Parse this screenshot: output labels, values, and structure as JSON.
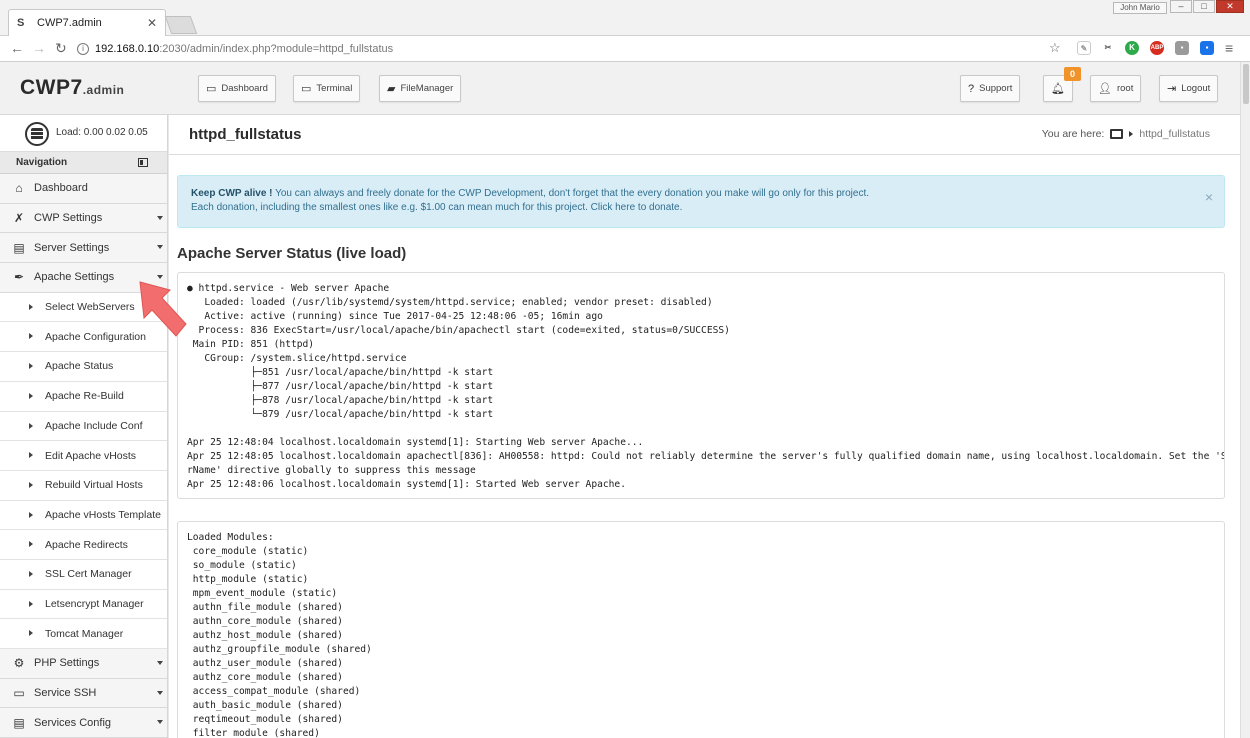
{
  "browser": {
    "tab_title": "CWP7.admin",
    "tab_favicon": "S",
    "user_badge": "John Mario",
    "url_host": "192.168.0.10",
    "url_rest": ":2030/admin/index.php?module=httpd_fullstatus"
  },
  "header": {
    "brand": "CWP7",
    "brand_sub": ".admin",
    "buttons": {
      "dashboard": "Dashboard",
      "terminal": "Terminal",
      "filemanager": "FileManager",
      "support": "Support",
      "user": "root",
      "logout": "Logout"
    },
    "notification_count": "0"
  },
  "sidebar": {
    "load": "Load: 0.00  0.02  0.05",
    "nav_heading": "Navigation",
    "items": [
      {
        "label": "Dashboard",
        "icon": "home-icon"
      },
      {
        "label": "CWP Settings",
        "icon": "tools-icon"
      },
      {
        "label": "Server Settings",
        "icon": "server-icon"
      },
      {
        "label": "Apache Settings",
        "icon": "feather-icon"
      }
    ],
    "apache_sub": [
      "Select WebServers",
      "Apache Configuration",
      "Apache Status",
      "Apache Re-Build",
      "Apache Include Conf",
      "Edit Apache vHosts",
      "Rebuild Virtual Hosts",
      "Apache vHosts Template",
      "Apache Redirects",
      "SSL Cert Manager",
      "Letsencrypt Manager",
      "Tomcat Manager"
    ],
    "items_after": [
      {
        "label": "PHP Settings",
        "icon": "gear-icon"
      },
      {
        "label": "Service SSH",
        "icon": "monitor-icon"
      },
      {
        "label": "Services Config",
        "icon": "server-icon"
      }
    ]
  },
  "main": {
    "page_title": "httpd_fullstatus",
    "you_are_here": "You are here:",
    "crumb_current": "httpd_fullstatus",
    "alert_bold": "Keep CWP alive !",
    "alert_line1": " You can always and freely donate for the CWP Development, don't forget that the every donation you make will go only for this project.",
    "alert_line2": "Each donation, including the smallest ones like e.g. $1.00 can mean much for this project. Click here to donate.",
    "section_title": "Apache Server Status (live load)",
    "status_output": "● httpd.service - Web server Apache\n   Loaded: loaded (/usr/lib/systemd/system/httpd.service; enabled; vendor preset: disabled)\n   Active: active (running) since Tue 2017-04-25 12:48:06 -05; 16min ago\n  Process: 836 ExecStart=/usr/local/apache/bin/apachectl start (code=exited, status=0/SUCCESS)\n Main PID: 851 (httpd)\n   CGroup: /system.slice/httpd.service\n           ├─851 /usr/local/apache/bin/httpd -k start\n           ├─877 /usr/local/apache/bin/httpd -k start\n           ├─878 /usr/local/apache/bin/httpd -k start\n           └─879 /usr/local/apache/bin/httpd -k start\n\nApr 25 12:48:04 localhost.localdomain systemd[1]: Starting Web server Apache...\nApr 25 12:48:05 localhost.localdomain apachectl[836]: AH00558: httpd: Could not reliably determine the server's fully qualified domain name, using localhost.localdomain. Set the 'Serve\nrName' directive globally to suppress this message\nApr 25 12:48:06 localhost.localdomain systemd[1]: Started Web server Apache.",
    "modules_output": "Loaded Modules:\n core_module (static)\n so_module (static)\n http_module (static)\n mpm_event_module (static)\n authn_file_module (shared)\n authn_core_module (shared)\n authz_host_module (shared)\n authz_groupfile_module (shared)\n authz_user_module (shared)\n authz_core_module (shared)\n access_compat_module (shared)\n auth_basic_module (shared)\n reqtimeout_module (shared)\n filter_module (shared)"
  },
  "colors": {
    "alert_bg": "#d9edf7",
    "badge": "#f0932b",
    "arrow": "#f26d6d"
  }
}
